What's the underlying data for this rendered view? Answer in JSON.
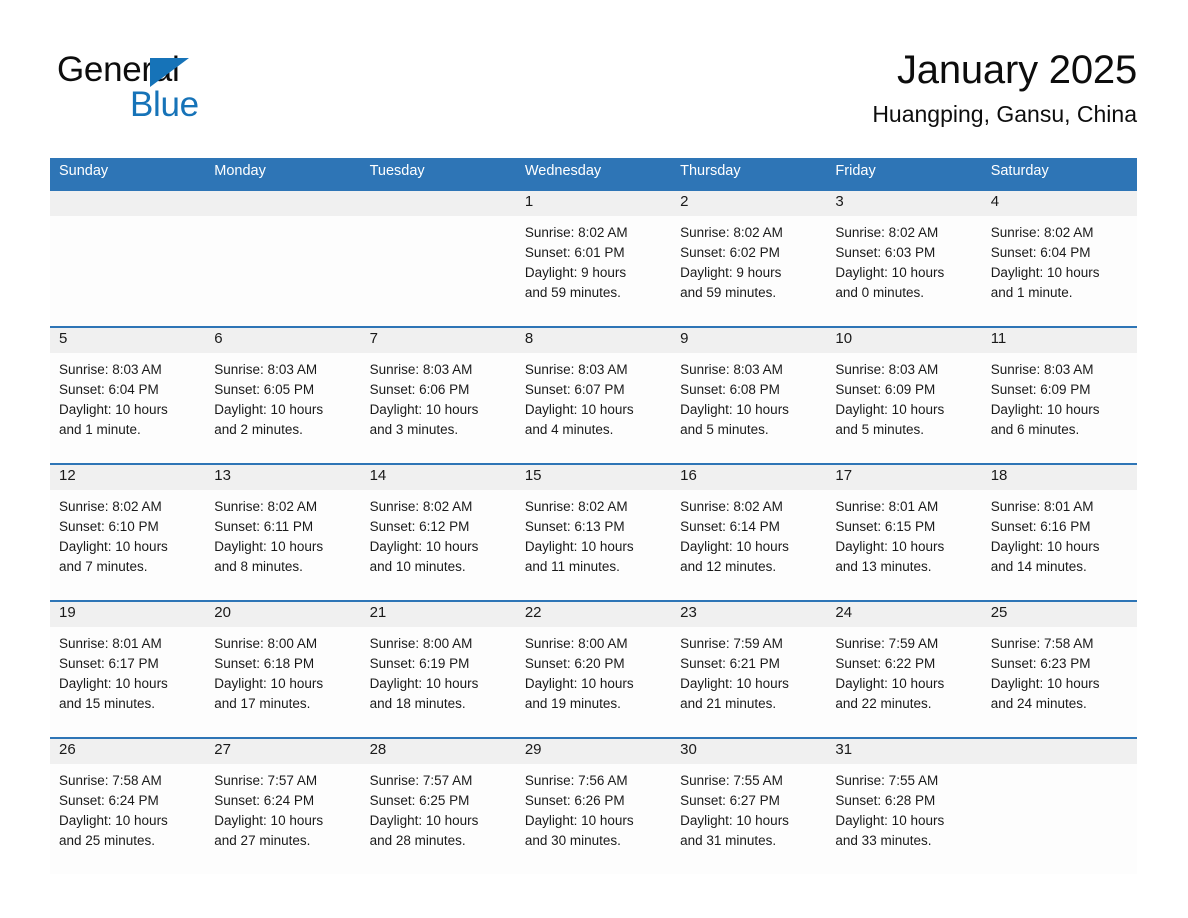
{
  "logo": {
    "word_top": "General",
    "word_bottom": "Blue",
    "triangle_color": "#1673b8",
    "top_color": "#0d0d0d"
  },
  "header": {
    "title": "January 2025",
    "subtitle": "Huangping, Gansu, China"
  },
  "theme": {
    "header_blue": "#2e75b6",
    "date_band_gray": "#f0f0f0",
    "cell_white": "#fdfdfd",
    "text": "#1a1a1a"
  },
  "weekdays": [
    "Sunday",
    "Monday",
    "Tuesday",
    "Wednesday",
    "Thursday",
    "Friday",
    "Saturday"
  ],
  "weeks": [
    {
      "days": [
        {
          "num": "",
          "l1": "",
          "l2": "",
          "l3": "",
          "l4": ""
        },
        {
          "num": "",
          "l1": "",
          "l2": "",
          "l3": "",
          "l4": ""
        },
        {
          "num": "",
          "l1": "",
          "l2": "",
          "l3": "",
          "l4": ""
        },
        {
          "num": "1",
          "l1": "Sunrise: 8:02 AM",
          "l2": "Sunset: 6:01 PM",
          "l3": "Daylight: 9 hours",
          "l4": "and 59 minutes."
        },
        {
          "num": "2",
          "l1": "Sunrise: 8:02 AM",
          "l2": "Sunset: 6:02 PM",
          "l3": "Daylight: 9 hours",
          "l4": "and 59 minutes."
        },
        {
          "num": "3",
          "l1": "Sunrise: 8:02 AM",
          "l2": "Sunset: 6:03 PM",
          "l3": "Daylight: 10 hours",
          "l4": "and 0 minutes."
        },
        {
          "num": "4",
          "l1": "Sunrise: 8:02 AM",
          "l2": "Sunset: 6:04 PM",
          "l3": "Daylight: 10 hours",
          "l4": "and 1 minute."
        }
      ]
    },
    {
      "days": [
        {
          "num": "5",
          "l1": "Sunrise: 8:03 AM",
          "l2": "Sunset: 6:04 PM",
          "l3": "Daylight: 10 hours",
          "l4": "and 1 minute."
        },
        {
          "num": "6",
          "l1": "Sunrise: 8:03 AM",
          "l2": "Sunset: 6:05 PM",
          "l3": "Daylight: 10 hours",
          "l4": "and 2 minutes."
        },
        {
          "num": "7",
          "l1": "Sunrise: 8:03 AM",
          "l2": "Sunset: 6:06 PM",
          "l3": "Daylight: 10 hours",
          "l4": "and 3 minutes."
        },
        {
          "num": "8",
          "l1": "Sunrise: 8:03 AM",
          "l2": "Sunset: 6:07 PM",
          "l3": "Daylight: 10 hours",
          "l4": "and 4 minutes."
        },
        {
          "num": "9",
          "l1": "Sunrise: 8:03 AM",
          "l2": "Sunset: 6:08 PM",
          "l3": "Daylight: 10 hours",
          "l4": "and 5 minutes."
        },
        {
          "num": "10",
          "l1": "Sunrise: 8:03 AM",
          "l2": "Sunset: 6:09 PM",
          "l3": "Daylight: 10 hours",
          "l4": "and 5 minutes."
        },
        {
          "num": "11",
          "l1": "Sunrise: 8:03 AM",
          "l2": "Sunset: 6:09 PM",
          "l3": "Daylight: 10 hours",
          "l4": "and 6 minutes."
        }
      ]
    },
    {
      "days": [
        {
          "num": "12",
          "l1": "Sunrise: 8:02 AM",
          "l2": "Sunset: 6:10 PM",
          "l3": "Daylight: 10 hours",
          "l4": "and 7 minutes."
        },
        {
          "num": "13",
          "l1": "Sunrise: 8:02 AM",
          "l2": "Sunset: 6:11 PM",
          "l3": "Daylight: 10 hours",
          "l4": "and 8 minutes."
        },
        {
          "num": "14",
          "l1": "Sunrise: 8:02 AM",
          "l2": "Sunset: 6:12 PM",
          "l3": "Daylight: 10 hours",
          "l4": "and 10 minutes."
        },
        {
          "num": "15",
          "l1": "Sunrise: 8:02 AM",
          "l2": "Sunset: 6:13 PM",
          "l3": "Daylight: 10 hours",
          "l4": "and 11 minutes."
        },
        {
          "num": "16",
          "l1": "Sunrise: 8:02 AM",
          "l2": "Sunset: 6:14 PM",
          "l3": "Daylight: 10 hours",
          "l4": "and 12 minutes."
        },
        {
          "num": "17",
          "l1": "Sunrise: 8:01 AM",
          "l2": "Sunset: 6:15 PM",
          "l3": "Daylight: 10 hours",
          "l4": "and 13 minutes."
        },
        {
          "num": "18",
          "l1": "Sunrise: 8:01 AM",
          "l2": "Sunset: 6:16 PM",
          "l3": "Daylight: 10 hours",
          "l4": "and 14 minutes."
        }
      ]
    },
    {
      "days": [
        {
          "num": "19",
          "l1": "Sunrise: 8:01 AM",
          "l2": "Sunset: 6:17 PM",
          "l3": "Daylight: 10 hours",
          "l4": "and 15 minutes."
        },
        {
          "num": "20",
          "l1": "Sunrise: 8:00 AM",
          "l2": "Sunset: 6:18 PM",
          "l3": "Daylight: 10 hours",
          "l4": "and 17 minutes."
        },
        {
          "num": "21",
          "l1": "Sunrise: 8:00 AM",
          "l2": "Sunset: 6:19 PM",
          "l3": "Daylight: 10 hours",
          "l4": "and 18 minutes."
        },
        {
          "num": "22",
          "l1": "Sunrise: 8:00 AM",
          "l2": "Sunset: 6:20 PM",
          "l3": "Daylight: 10 hours",
          "l4": "and 19 minutes."
        },
        {
          "num": "23",
          "l1": "Sunrise: 7:59 AM",
          "l2": "Sunset: 6:21 PM",
          "l3": "Daylight: 10 hours",
          "l4": "and 21 minutes."
        },
        {
          "num": "24",
          "l1": "Sunrise: 7:59 AM",
          "l2": "Sunset: 6:22 PM",
          "l3": "Daylight: 10 hours",
          "l4": "and 22 minutes."
        },
        {
          "num": "25",
          "l1": "Sunrise: 7:58 AM",
          "l2": "Sunset: 6:23 PM",
          "l3": "Daylight: 10 hours",
          "l4": "and 24 minutes."
        }
      ]
    },
    {
      "days": [
        {
          "num": "26",
          "l1": "Sunrise: 7:58 AM",
          "l2": "Sunset: 6:24 PM",
          "l3": "Daylight: 10 hours",
          "l4": "and 25 minutes."
        },
        {
          "num": "27",
          "l1": "Sunrise: 7:57 AM",
          "l2": "Sunset: 6:24 PM",
          "l3": "Daylight: 10 hours",
          "l4": "and 27 minutes."
        },
        {
          "num": "28",
          "l1": "Sunrise: 7:57 AM",
          "l2": "Sunset: 6:25 PM",
          "l3": "Daylight: 10 hours",
          "l4": "and 28 minutes."
        },
        {
          "num": "29",
          "l1": "Sunrise: 7:56 AM",
          "l2": "Sunset: 6:26 PM",
          "l3": "Daylight: 10 hours",
          "l4": "and 30 minutes."
        },
        {
          "num": "30",
          "l1": "Sunrise: 7:55 AM",
          "l2": "Sunset: 6:27 PM",
          "l3": "Daylight: 10 hours",
          "l4": "and 31 minutes."
        },
        {
          "num": "31",
          "l1": "Sunrise: 7:55 AM",
          "l2": "Sunset: 6:28 PM",
          "l3": "Daylight: 10 hours",
          "l4": "and 33 minutes."
        },
        {
          "num": "",
          "l1": "",
          "l2": "",
          "l3": "",
          "l4": ""
        }
      ]
    }
  ]
}
